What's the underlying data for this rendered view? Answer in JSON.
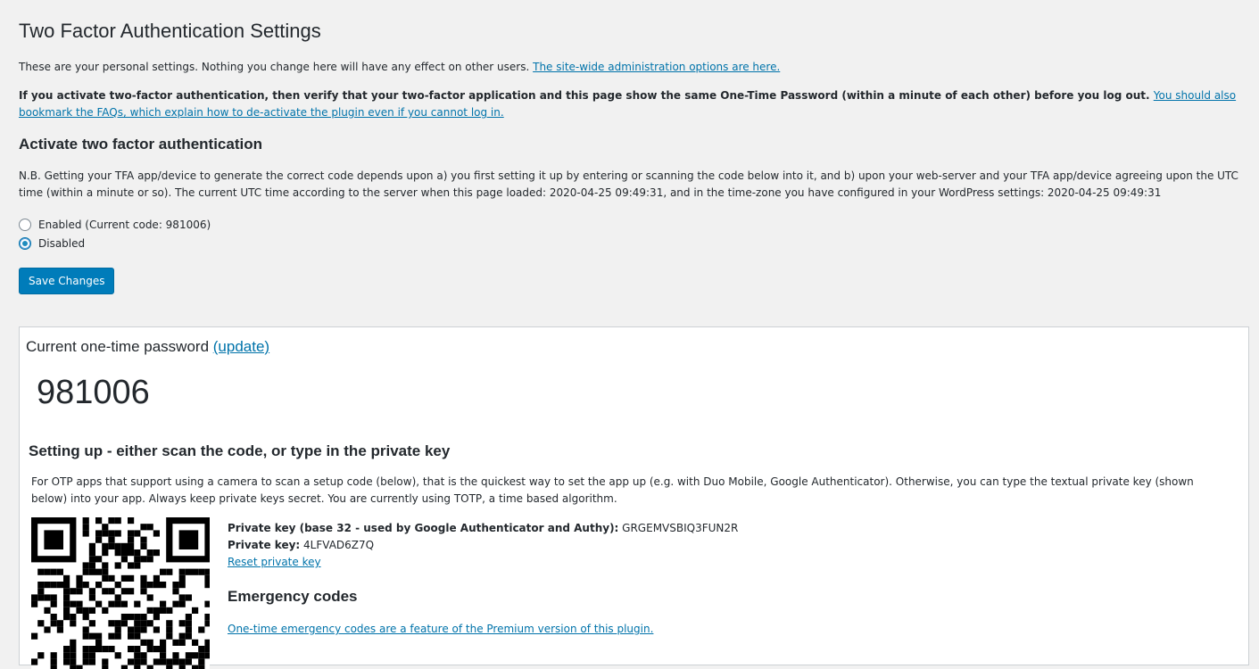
{
  "page": {
    "title": "Two Factor Authentication Settings",
    "intro_text": "These are your personal settings. Nothing you change here will have any effect on other users. ",
    "intro_link": "The site-wide administration options are here.",
    "warning_bold": "If you activate two-factor authentication, then verify that your two-factor application and this page show the same One-Time Password (within a minute of each other) before you log out. ",
    "warning_link": "You should also bookmark the FAQs, which explain how to de-activate the plugin even if you cannot log in."
  },
  "activate": {
    "heading": "Activate two factor authentication",
    "note": "N.B. Getting your TFA app/device to generate the correct code depends upon a) you first setting it up by entering or scanning the code below into it, and b) upon your web-server and your TFA app/device agreeing upon the UTC time (within a minute or so). The current UTC time according to the server when this page loaded: 2020-04-25 09:49:31, and in the time-zone you have configured in your WordPress settings: 2020-04-25 09:49:31",
    "options": [
      {
        "label": "Enabled (Current code: 981006)",
        "checked": false
      },
      {
        "label": "Disabled",
        "checked": true
      }
    ],
    "save_label": "Save Changes"
  },
  "otp": {
    "title": "Current one-time password ",
    "update_link": "(update)",
    "code": "981006"
  },
  "setup": {
    "heading": "Setting up - either scan the code, or type in the private key",
    "description": "For OTP apps that support using a camera to scan a setup code (below), that is the quickest way to set the app up (e.g. with Duo Mobile, Google Authenticator). Otherwise, you can type the textual private key (shown below) into your app. Always keep private keys secret. You are currently using TOTP, a time based algorithm.",
    "key32_label": "Private key (base 32 - used by Google Authenticator and Authy):",
    "key32_value": " GRGEMVSBIQ3FUN2R",
    "key_label": "Private key:",
    "key_value": " 4LFVAD6Z7Q",
    "reset_link": "Reset private key"
  },
  "emergency": {
    "heading": "Emergency codes",
    "link": "One-time emergency codes are a feature of the Premium version of this plugin."
  },
  "colors": {
    "accent": "#0073aa",
    "button": "#007cba",
    "background": "#f1f1f1"
  }
}
